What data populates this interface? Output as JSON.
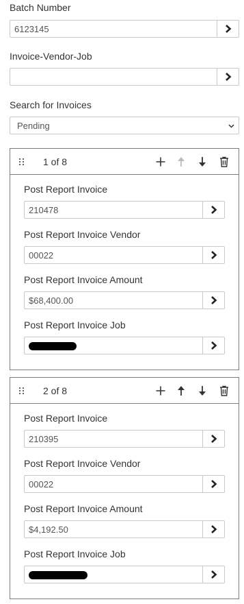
{
  "batch": {
    "label": "Batch Number",
    "value": "6123145"
  },
  "ivj": {
    "label": "Invoice-Vendor-Job",
    "value": ""
  },
  "search": {
    "label": "Search for Invoices",
    "selected": "Pending"
  },
  "cards": [
    {
      "count": "1 of 8",
      "invoice_label": "Post Report Invoice",
      "invoice_value": "210478",
      "vendor_label": "Post Report Invoice Vendor",
      "vendor_value": "00022",
      "amount_label": "Post Report Invoice Amount",
      "amount_value": "$68,400.00",
      "job_label": "Post Report Invoice Job"
    },
    {
      "count": "2 of 8",
      "invoice_label": "Post Report Invoice",
      "invoice_value": "210395",
      "vendor_label": "Post Report Invoice Vendor",
      "vendor_value": "00022",
      "amount_label": "Post Report Invoice Amount",
      "amount_value": "$4,192.50",
      "job_label": "Post Report Invoice Job"
    }
  ],
  "colors": {
    "border": "#c8c8c8",
    "card_border": "#7a7a7a",
    "icon": "#333333",
    "icon_disabled": "#bbbbbb"
  },
  "icons": [
    "chevron-right-icon",
    "drag-handle-icon",
    "plus-icon",
    "arrow-up-icon",
    "arrow-down-icon",
    "trash-icon",
    "chevron-down-icon"
  ]
}
